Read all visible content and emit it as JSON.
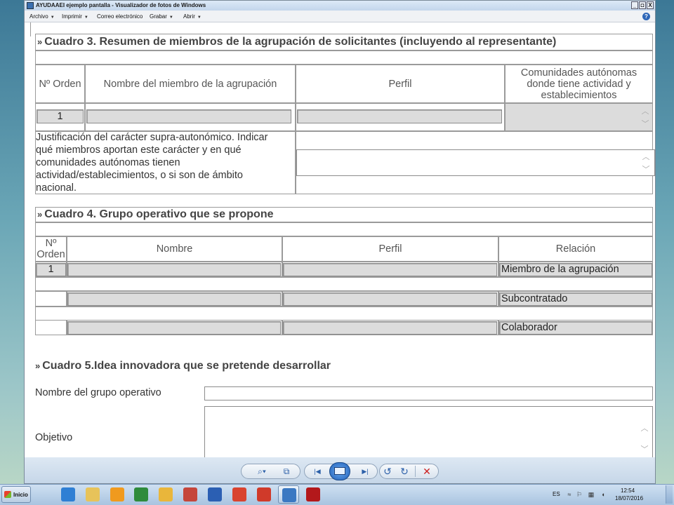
{
  "window": {
    "title": "AYUDAAEI ejemplo pantalla - Visualizador de fotos de Windows",
    "controls": {
      "minimize": "_",
      "restore": "◘",
      "close": "X"
    }
  },
  "menu": {
    "items": [
      {
        "label": "Archivo"
      },
      {
        "label": "Imprimir"
      },
      {
        "label": "Correo electrónico"
      },
      {
        "label": "Grabar"
      },
      {
        "label": "Abrir"
      }
    ],
    "help": "?"
  },
  "cuadro3": {
    "title": "Cuadro 3. Resumen de miembros de la agrupación de solicitantes (incluyendo al representante)",
    "headers": {
      "orden": "Nº Orden",
      "nombre": "Nombre del miembro de la agrupación",
      "perfil": "Perfil",
      "ccaa": "Comunidades autónomas donde tiene actividad y establecimientos"
    },
    "row1": {
      "orden": "1",
      "nombre": "",
      "perfil": "",
      "ccaa": ""
    },
    "justificacion_label": "Justificación del carácter supra-autonómico. Indicar qué miembros aportan este carácter y en qué comunidades autónomas tienen actividad/establecimientos, o si son de ámbito nacional.",
    "justificacion_lines": [
      "Justificación del carácter supra-autonómico. Indicar",
      "qué miembros aportan este carácter y en qué",
      "comunidades autónomas tienen",
      "actividad/establecimientos, o si son de ámbito",
      "nacional."
    ],
    "justificacion_value": ""
  },
  "cuadro4": {
    "title": "Cuadro 4. Grupo operativo que se propone",
    "headers": {
      "orden_1": "Nº",
      "orden_2": "Orden",
      "nombre": "Nombre",
      "perfil": "Perfil",
      "relacion": "Relación"
    },
    "rows": [
      {
        "orden": "1",
        "nombre": "",
        "perfil": "",
        "relacion": "Miembro de la agrupación"
      },
      {
        "orden": "",
        "nombre": "",
        "perfil": "",
        "relacion": "Subcontratado"
      },
      {
        "orden": "",
        "nombre": "",
        "perfil": "",
        "relacion": "Colaborador"
      }
    ]
  },
  "cuadro5": {
    "title": "Cuadro 5.Idea innovadora que se pretende desarrollar",
    "nombre_label": "Nombre del grupo operativo",
    "nombre_value": "",
    "objetivo_label": "Objetivo",
    "objetivo_value": ""
  },
  "viewer_toolbar": {
    "zoom": "⌕▾",
    "fit": "⧉",
    "prev": "|◀",
    "next": "▶|",
    "rotate_ccw": "↺",
    "rotate_cw": "↻",
    "delete": "✕"
  },
  "taskbar": {
    "start_label": "Inicio",
    "apps": [
      {
        "icon": "internet-explorer-icon",
        "color": "#2f7fd4"
      },
      {
        "icon": "file-explorer-icon",
        "color": "#e7c35a"
      },
      {
        "icon": "media-player-icon",
        "color": "#f09a1e"
      },
      {
        "icon": "excel-icon",
        "color": "#2f8b3c"
      },
      {
        "icon": "outlook-icon",
        "color": "#e9b63b"
      },
      {
        "icon": "powerpoint-icon",
        "color": "#c5463b"
      },
      {
        "icon": "word-icon",
        "color": "#2b5fb3"
      },
      {
        "icon": "chrome-icon",
        "color": "#d9432f"
      },
      {
        "icon": "pdf-reader-icon",
        "color": "#d03a2a"
      },
      {
        "icon": "photo-viewer-icon",
        "color": "#3a78c2"
      },
      {
        "icon": "acrobat-icon",
        "color": "#b3181b"
      }
    ],
    "language": "ES",
    "time": "12:54",
    "date": "18/07/2016"
  }
}
